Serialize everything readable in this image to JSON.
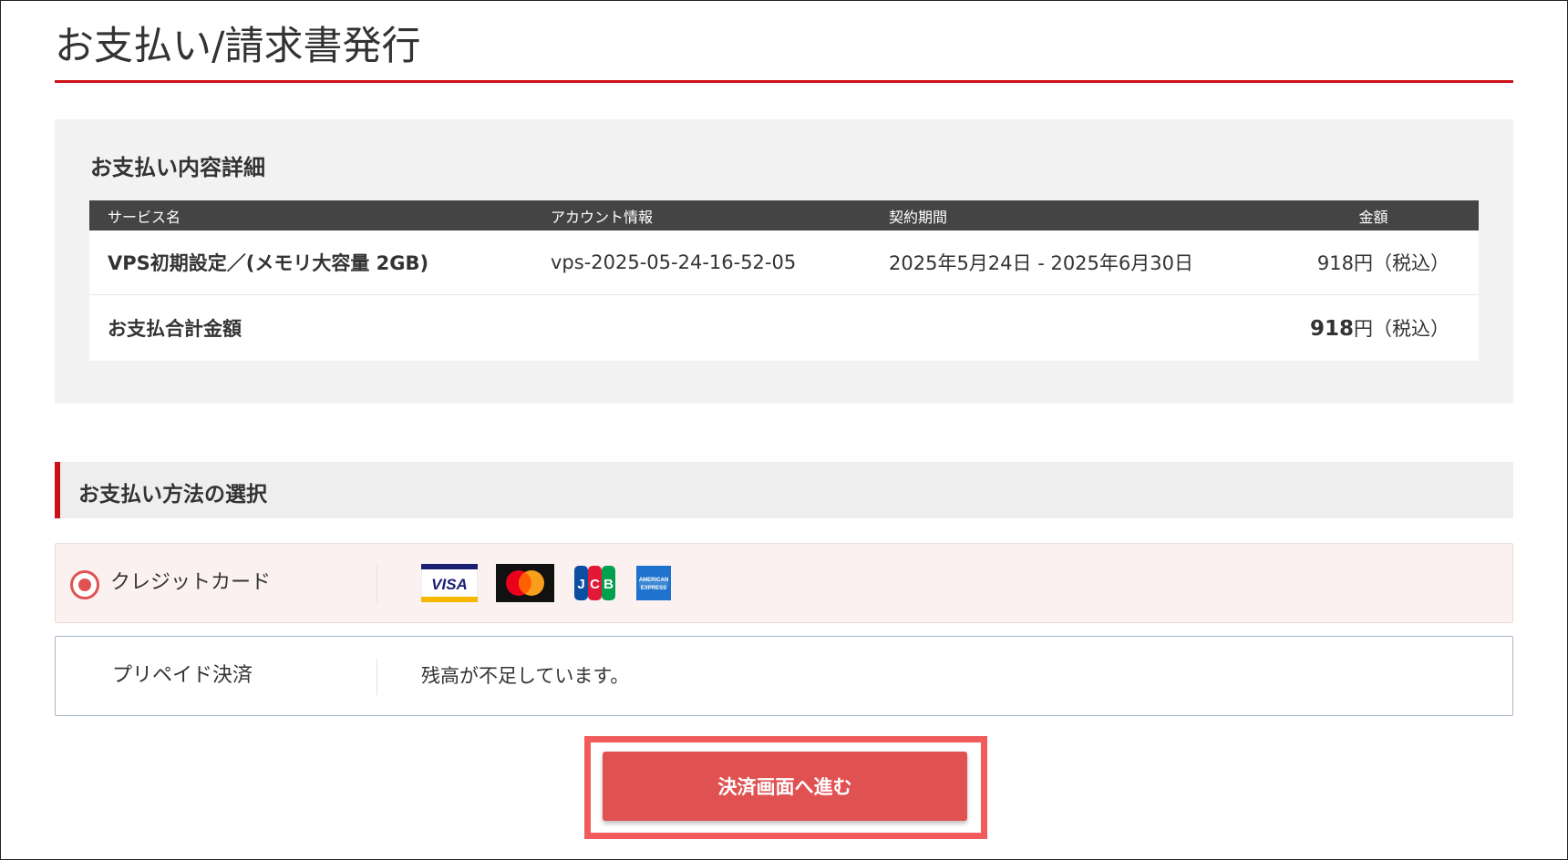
{
  "page": {
    "title": "お支払い/請求書発行"
  },
  "summary": {
    "heading": "お支払い内容詳細",
    "columns": {
      "service": "サービス名",
      "account": "アカウント情報",
      "period": "契約期間",
      "amount": "金額"
    },
    "rows": [
      {
        "service": "VPS初期設定／(メモリ大容量 2GB)",
        "account": "vps-2025-05-24-16-52-05",
        "period": "2025年5月24日 - 2025年6月30日",
        "amount": "918円（税込）"
      }
    ],
    "total": {
      "label": "お支払合計金額",
      "amount_number": "918",
      "amount_suffix": "円（税込）"
    }
  },
  "payment_methods": {
    "heading": "お支払い方法の選択",
    "options": [
      {
        "label": "クレジットカード",
        "selected": true,
        "brands": [
          "VISA",
          "Mastercard",
          "JCB",
          "American Express"
        ]
      },
      {
        "label": "プリペイド決済",
        "selected": false,
        "message": "残高が不足しています。"
      }
    ]
  },
  "actions": {
    "proceed_label": "決済画面へ進む"
  },
  "colors": {
    "accent_red": "#cc1016",
    "button_red": "#e05252",
    "table_header": "#444444"
  }
}
